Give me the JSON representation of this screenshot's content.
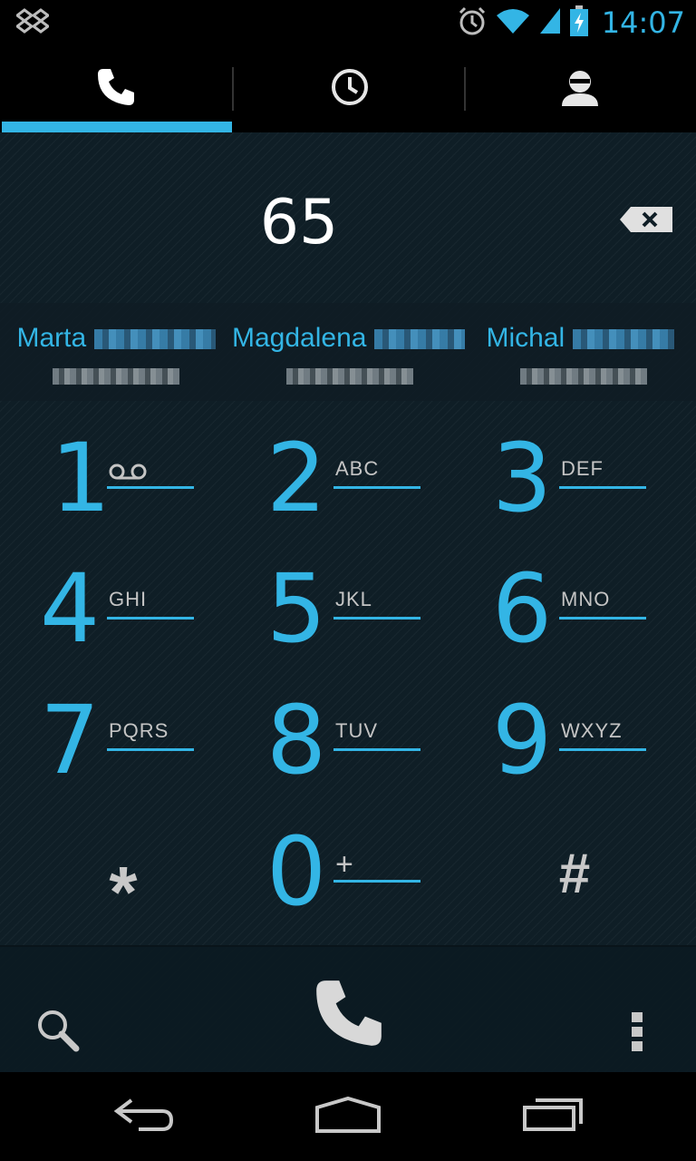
{
  "status_bar": {
    "time": "14:07",
    "left_icons": [
      "dropbox-icon"
    ],
    "right_icons": [
      "alarm-icon",
      "wifi-icon",
      "signal-icon",
      "battery-charging-icon"
    ],
    "accent_color": "#33b5e5"
  },
  "tabs": [
    {
      "icon": "phone-icon",
      "selected": true
    },
    {
      "icon": "clock-icon",
      "selected": false
    },
    {
      "icon": "contact-icon",
      "selected": false
    }
  ],
  "dialer": {
    "digits": "65",
    "backspace_icon": "backspace-icon"
  },
  "suggestions": [
    {
      "name": "Marta",
      "number_obscured": true
    },
    {
      "name": "Magdalena",
      "number_obscured": true
    },
    {
      "name": "Michal",
      "number_obscured": true
    }
  ],
  "keypad": [
    {
      "digit": "1",
      "letters": "",
      "icon": "voicemail-icon"
    },
    {
      "digit": "2",
      "letters": "ABC"
    },
    {
      "digit": "3",
      "letters": "DEF"
    },
    {
      "digit": "4",
      "letters": "GHI"
    },
    {
      "digit": "5",
      "letters": "JKL"
    },
    {
      "digit": "6",
      "letters": "MNO"
    },
    {
      "digit": "7",
      "letters": "PQRS"
    },
    {
      "digit": "8",
      "letters": "TUV"
    },
    {
      "digit": "9",
      "letters": "WXYZ"
    },
    {
      "digit": "*",
      "letters": ""
    },
    {
      "digit": "0",
      "letters": "+"
    },
    {
      "digit": "#",
      "letters": ""
    }
  ],
  "actions": {
    "search_icon": "search-icon",
    "call_icon": "phone-call-icon",
    "overflow_icon": "overflow-menu-icon"
  },
  "navbar": {
    "back_icon": "back-icon",
    "home_icon": "home-icon",
    "recents_icon": "recents-icon"
  }
}
